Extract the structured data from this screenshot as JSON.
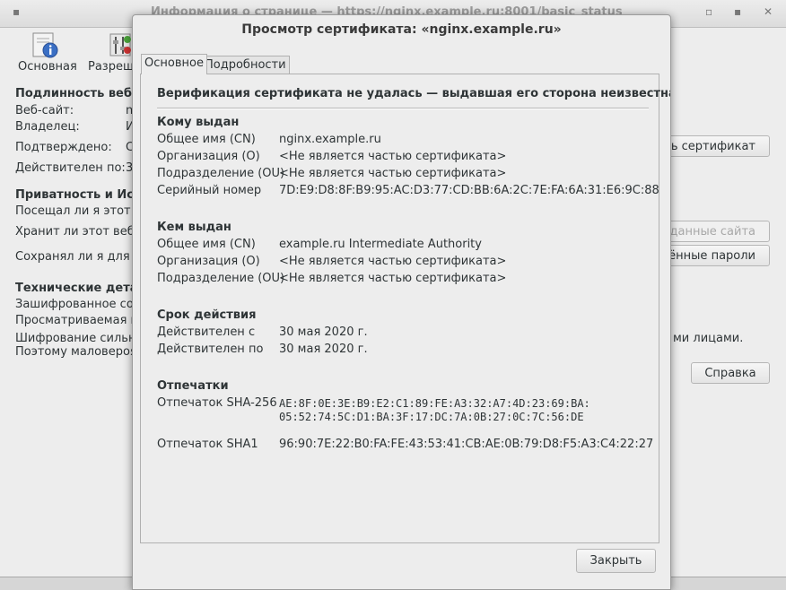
{
  "bg": {
    "window_title": "Информация о странице — https://nginx.example.ru:8001/basic_status",
    "wm_menu": "▪",
    "wm_min": "▫",
    "wm_max": "▪",
    "wm_close": "✕",
    "toolbar": [
      {
        "label": "Основная",
        "icon": "info-icon"
      },
      {
        "label": "Разреше",
        "icon": "permissions-icon"
      }
    ],
    "identity_heading": "Подлинность веб-с",
    "website_label": "Веб-сайт:",
    "website_value": "n",
    "owner_label": "Владелец:",
    "owner_value": "И",
    "verified_label": "Подтверждено:",
    "verified_value": "С",
    "valid_label": "Действителен по:",
    "valid_value": "3",
    "view_cert_button": "ть сертификат",
    "privacy_heading": "Приватность и Исто",
    "visited_text": "Посещал ли я этот в",
    "stores_text": "Хранит ли этот веб-с",
    "saved_text": "Сохранял ли я для э",
    "clear_data_button": "данные сайта",
    "saved_passwords_button": "нённые пароли",
    "tech_heading": "Технические детал",
    "encrypted_text": "Зашифрованное соед",
    "viewed_text": "Просматриваемая ва",
    "cipher_text": "Шифрование сильно",
    "cipher_tail": "ми лицами.",
    "unlikely_text": "Поэтому маловероят",
    "help_button": "Справка"
  },
  "dialog": {
    "title": "Просмотр сертификата: «nginx.example.ru»",
    "tabs": [
      "Основное",
      "Подробности"
    ],
    "warning": "Верификация сертификата не удалась — выдавшая его сторона неизвестна.",
    "issued_to": {
      "heading": "Кому выдан",
      "rows": [
        {
          "label": "Общее имя (CN)",
          "value": "nginx.example.ru"
        },
        {
          "label": "Организация (O)",
          "value": "<Не является частью сертификата>"
        },
        {
          "label": "Подразделение (OU)",
          "value": "<Не является частью сертификата>"
        },
        {
          "label": "Серийный номер",
          "value": "7D:E9:D8:8F:B9:95:AC:D3:77:CD:BB:6A:2C:7E:FA:6A:31:E6:9C:88"
        }
      ]
    },
    "issued_by": {
      "heading": "Кем выдан",
      "rows": [
        {
          "label": "Общее имя (CN)",
          "value": "example.ru Intermediate Authority"
        },
        {
          "label": "Организация (O)",
          "value": "<Не является частью сертификата>"
        },
        {
          "label": "Подразделение (OU)",
          "value": "<Не является частью сертификата>"
        }
      ]
    },
    "validity": {
      "heading": "Срок действия",
      "rows": [
        {
          "label": "Действителен с",
          "value": "30 мая 2020 г."
        },
        {
          "label": "Действителен по",
          "value": "30 мая 2020 г."
        }
      ]
    },
    "fingerprints": {
      "heading": "Отпечатки",
      "sha256_label": "Отпечаток SHA-256",
      "sha256_line1": "AE:8F:0E:3E:B9:E2:C1:89:FE:A3:32:A7:4D:23:69:BA:",
      "sha256_line2": "05:52:74:5C:D1:BA:3F:17:DC:7A:0B:27:0C:7C:56:DE",
      "sha1_label": "Отпечаток SHA1",
      "sha1_value": "96:90:7E:22:B0:FA:FE:43:53:41:CB:AE:0B:79:D8:F5:A3:C4:22:27"
    },
    "close_button": "Закрыть"
  }
}
